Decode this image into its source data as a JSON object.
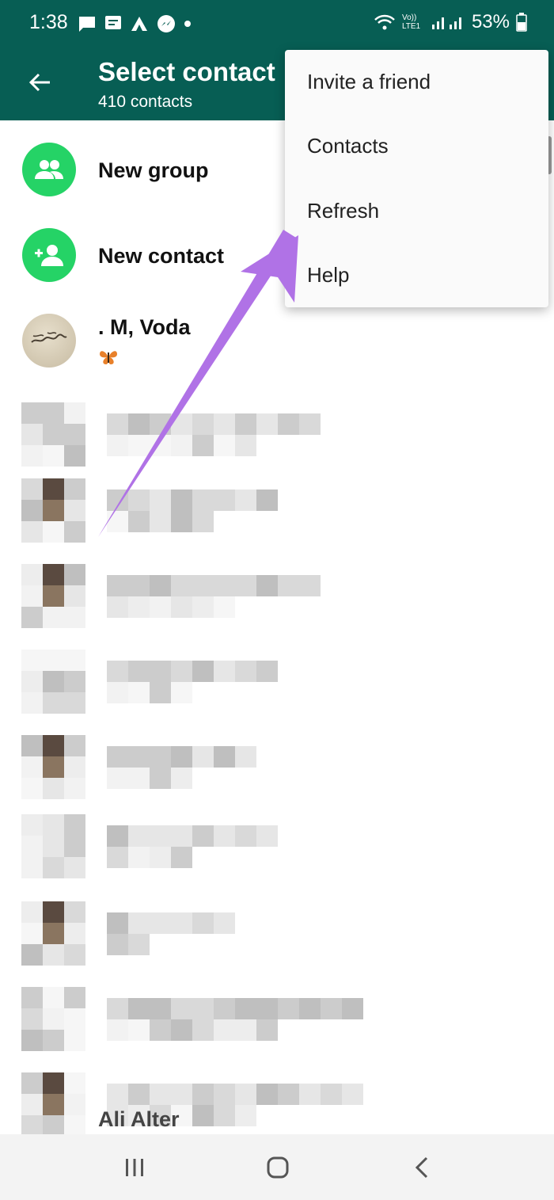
{
  "status_bar": {
    "time": "1:38",
    "battery": "53%",
    "network_label": "Vo)) LTE1"
  },
  "header": {
    "title": "Select contact",
    "subtitle": "410 contacts"
  },
  "overflow_menu": {
    "items": [
      "Invite a friend",
      "Contacts",
      "Refresh",
      "Help"
    ]
  },
  "actions": {
    "new_group": "New group",
    "new_contact": "New contact"
  },
  "contacts": [
    {
      "name": ". M, Voda",
      "status_icon": "butterfly-emoji"
    }
  ],
  "partial_contact_name": "Ali Alter",
  "colors": {
    "brand_dark": "#075e54",
    "accent_green": "#25d366",
    "annotation_arrow": "#b072e6"
  }
}
